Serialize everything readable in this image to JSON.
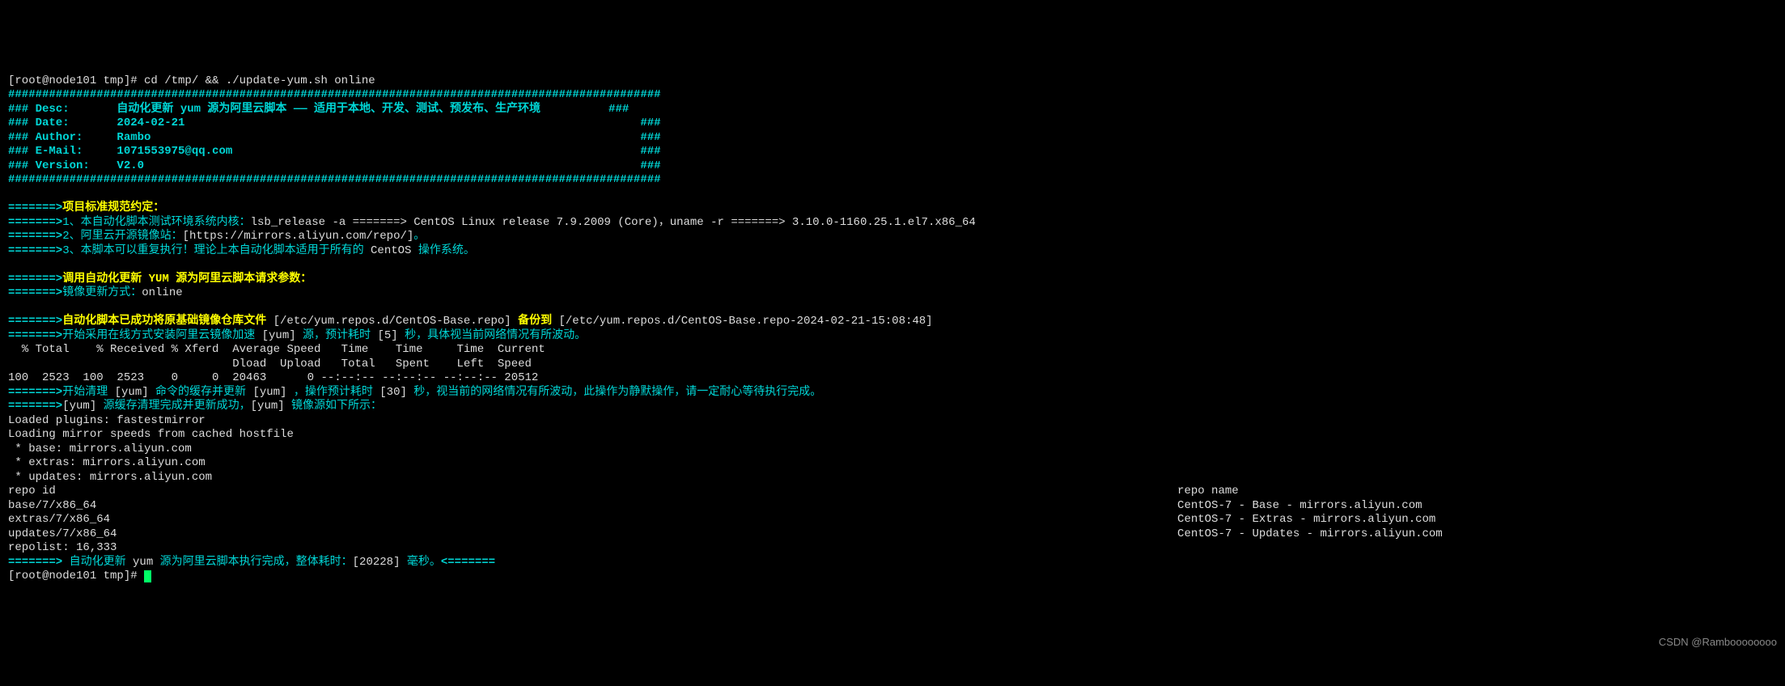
{
  "prompt1": "[root@node101 tmp]# cd /tmp/ && ./update-yum.sh online",
  "hashline": "################################################################################################",
  "hdr_desc": "### Desc:       自动化更新 yum 源为阿里云脚本 —— 适用于本地、开发、测试、预发布、生产环境          ###",
  "hdr_date": "### Date:       2024-02-21                                                                   ###",
  "hdr_author": "### Author:     Rambo                                                                        ###",
  "hdr_email": "### E-Mail:     1071553975@qq.com                                                            ###",
  "hdr_version": "### Version:    V2.0                                                                         ###",
  "arrow": "=======>",
  "std_title": "项目标准规范约定：",
  "std_1a": "1、本自动化脚本测试环境系统内核：",
  "std_1b": "lsb_release -a =======> CentOS Linux release 7.9.2009 (Core)，uname -r =======> 3.10.0-1160.25.1.el7.x86_64",
  "std_2a": "2、阿里云开源镜像站：",
  "std_2b": "[https://mirrors.aliyun.com/repo/]",
  "std_2c": "。",
  "std_3a": "3、本脚本可以重复执行！理论上本自动化脚本适用于所有的 ",
  "std_3b": "CentOS",
  "std_3c": " 操作系统。",
  "call_title": "调用自动化更新 YUM 源为阿里云脚本请求参数：",
  "call_mode_a": "镜像更新方式：",
  "call_mode_b": "online",
  "bk_a": "自动化脚本已成功将原基础镜像仓库文件 ",
  "bk_b": "[/etc/yum.repos.d/CentOS-Base.repo]",
  "bk_c": " 备份到 ",
  "bk_d": "[/etc/yum.repos.d/CentOS-Base.repo-2024-02-21-15:08:48]",
  "inst_a": "开始采用在线方式安装阿里云镜像加速 ",
  "inst_b": "[yum]",
  "inst_c": " 源，预计耗时 ",
  "inst_d": "[5]",
  "inst_e": " 秒，具体视当前网络情况有所波动。",
  "curl_h1": "  % Total    % Received % Xferd  Average Speed   Time    Time     Time  Current",
  "curl_h2": "                                 Dload  Upload   Total   Spent    Left  Speed",
  "curl_ln": "100  2523  100  2523    0     0  20463      0 --:--:-- --:--:-- --:--:-- 20512",
  "clean_a": "开始清理 ",
  "clean_b": "[yum]",
  "clean_c": " 命令的缓存并更新 ",
  "clean_d": "[yum]",
  "clean_e": " ，操作预计耗时 ",
  "clean_f": "[30]",
  "clean_g": " 秒，视当前的网络情况有所波动，此操作为静默操作，请一定耐心等待执行完成。",
  "done_a": "[yum]",
  "done_b": " 源缓存清理完成并更新成功，",
  "done_c": "[yum]",
  "done_d": " 镜像源如下所示：",
  "plugins": "Loaded plugins: fastestmirror",
  "loading": "Loading mirror speeds from cached hostfile",
  "m_base": " * base: mirrors.aliyun.com",
  "m_extras": " * extras: mirrors.aliyun.com",
  "m_updates": " * updates: mirrors.aliyun.com",
  "col_id": "repo id",
  "col_name": "repo name",
  "r1_id": "base/7/x86_64",
  "r1_name": "CentOS-7 - Base - mirrors.aliyun.com",
  "r2_id": "extras/7/x86_64",
  "r2_name": "CentOS-7 - Extras - mirrors.aliyun.com",
  "r3_id": "updates/7/x86_64",
  "r3_name": "CentOS-7 - Updates - mirrors.aliyun.com",
  "repolist": "repolist: 16,333",
  "fin_a": " 自动化更新 ",
  "fin_b": "yum",
  "fin_c": " 源为阿里云脚本执行完成，整体耗时：",
  "fin_d": "[20228]",
  "fin_e": " 毫秒。",
  "rev_arrow": "<=======",
  "prompt2": "[root@node101 tmp]# ",
  "watermark": "CSDN @Ramboooooooo"
}
